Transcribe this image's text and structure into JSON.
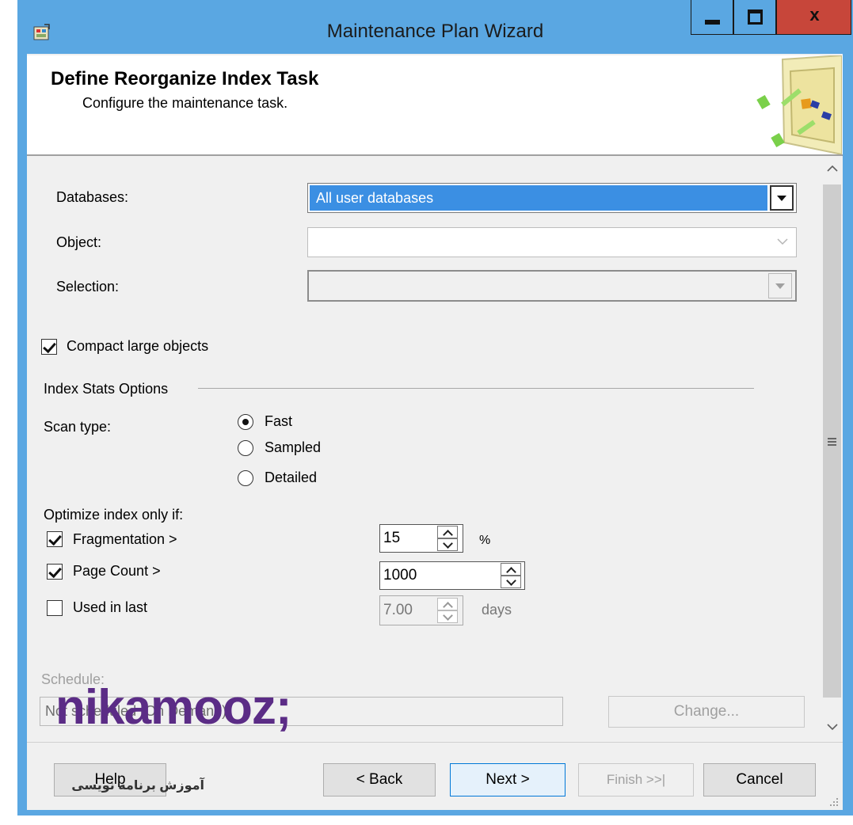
{
  "window": {
    "title": "Maintenance Plan Wizard",
    "close_glyph": "x"
  },
  "header": {
    "title": "Define Reorganize Index Task",
    "subtitle": "Configure the maintenance task."
  },
  "form": {
    "databases_label": "Databases:",
    "databases_value": "All user databases",
    "object_label": "Object:",
    "object_value": "",
    "selection_label": "Selection:",
    "selection_value": "",
    "compact_label": "Compact large objects",
    "compact_checked": true
  },
  "index_stats": {
    "group_label": "Index Stats Options",
    "scan_type_label": "Scan type:",
    "options": [
      "Fast",
      "Sampled",
      "Detailed"
    ],
    "selected": "Fast"
  },
  "optimize": {
    "label": "Optimize index only if:",
    "fragmentation_label": "Fragmentation >",
    "fragmentation_checked": true,
    "fragmentation_value": "15",
    "fragmentation_unit": "%",
    "page_count_label": "Page Count >",
    "page_count_checked": true,
    "page_count_value": "1000",
    "used_label": "Used  in last",
    "used_checked": false,
    "used_value": "7.00",
    "used_unit": "days"
  },
  "schedule": {
    "label": "Schedule:",
    "value": "Not scheduled (On Demand)",
    "change_label": "Change..."
  },
  "buttons": {
    "help": "Help",
    "back": "< Back",
    "next": "Next >",
    "finish": "Finish >>|",
    "cancel": "Cancel"
  },
  "watermark": {
    "brand": "nikamooz;",
    "tagline": "آموزش برنامه نویسی"
  },
  "icons": {
    "app": "wizard-app-icon",
    "minimize": "minimize-icon",
    "maximize": "maximize-icon",
    "close": "close-icon",
    "scroll_up": "chevron-up-icon",
    "scroll_down": "chevron-down-icon"
  },
  "colors": {
    "title_bar": "#5aa7e2",
    "close_button": "#c7463a",
    "selection_highlight": "#3b8fe3",
    "dialog_bg": "#f0f0f0",
    "watermark": "#5b2c86"
  }
}
